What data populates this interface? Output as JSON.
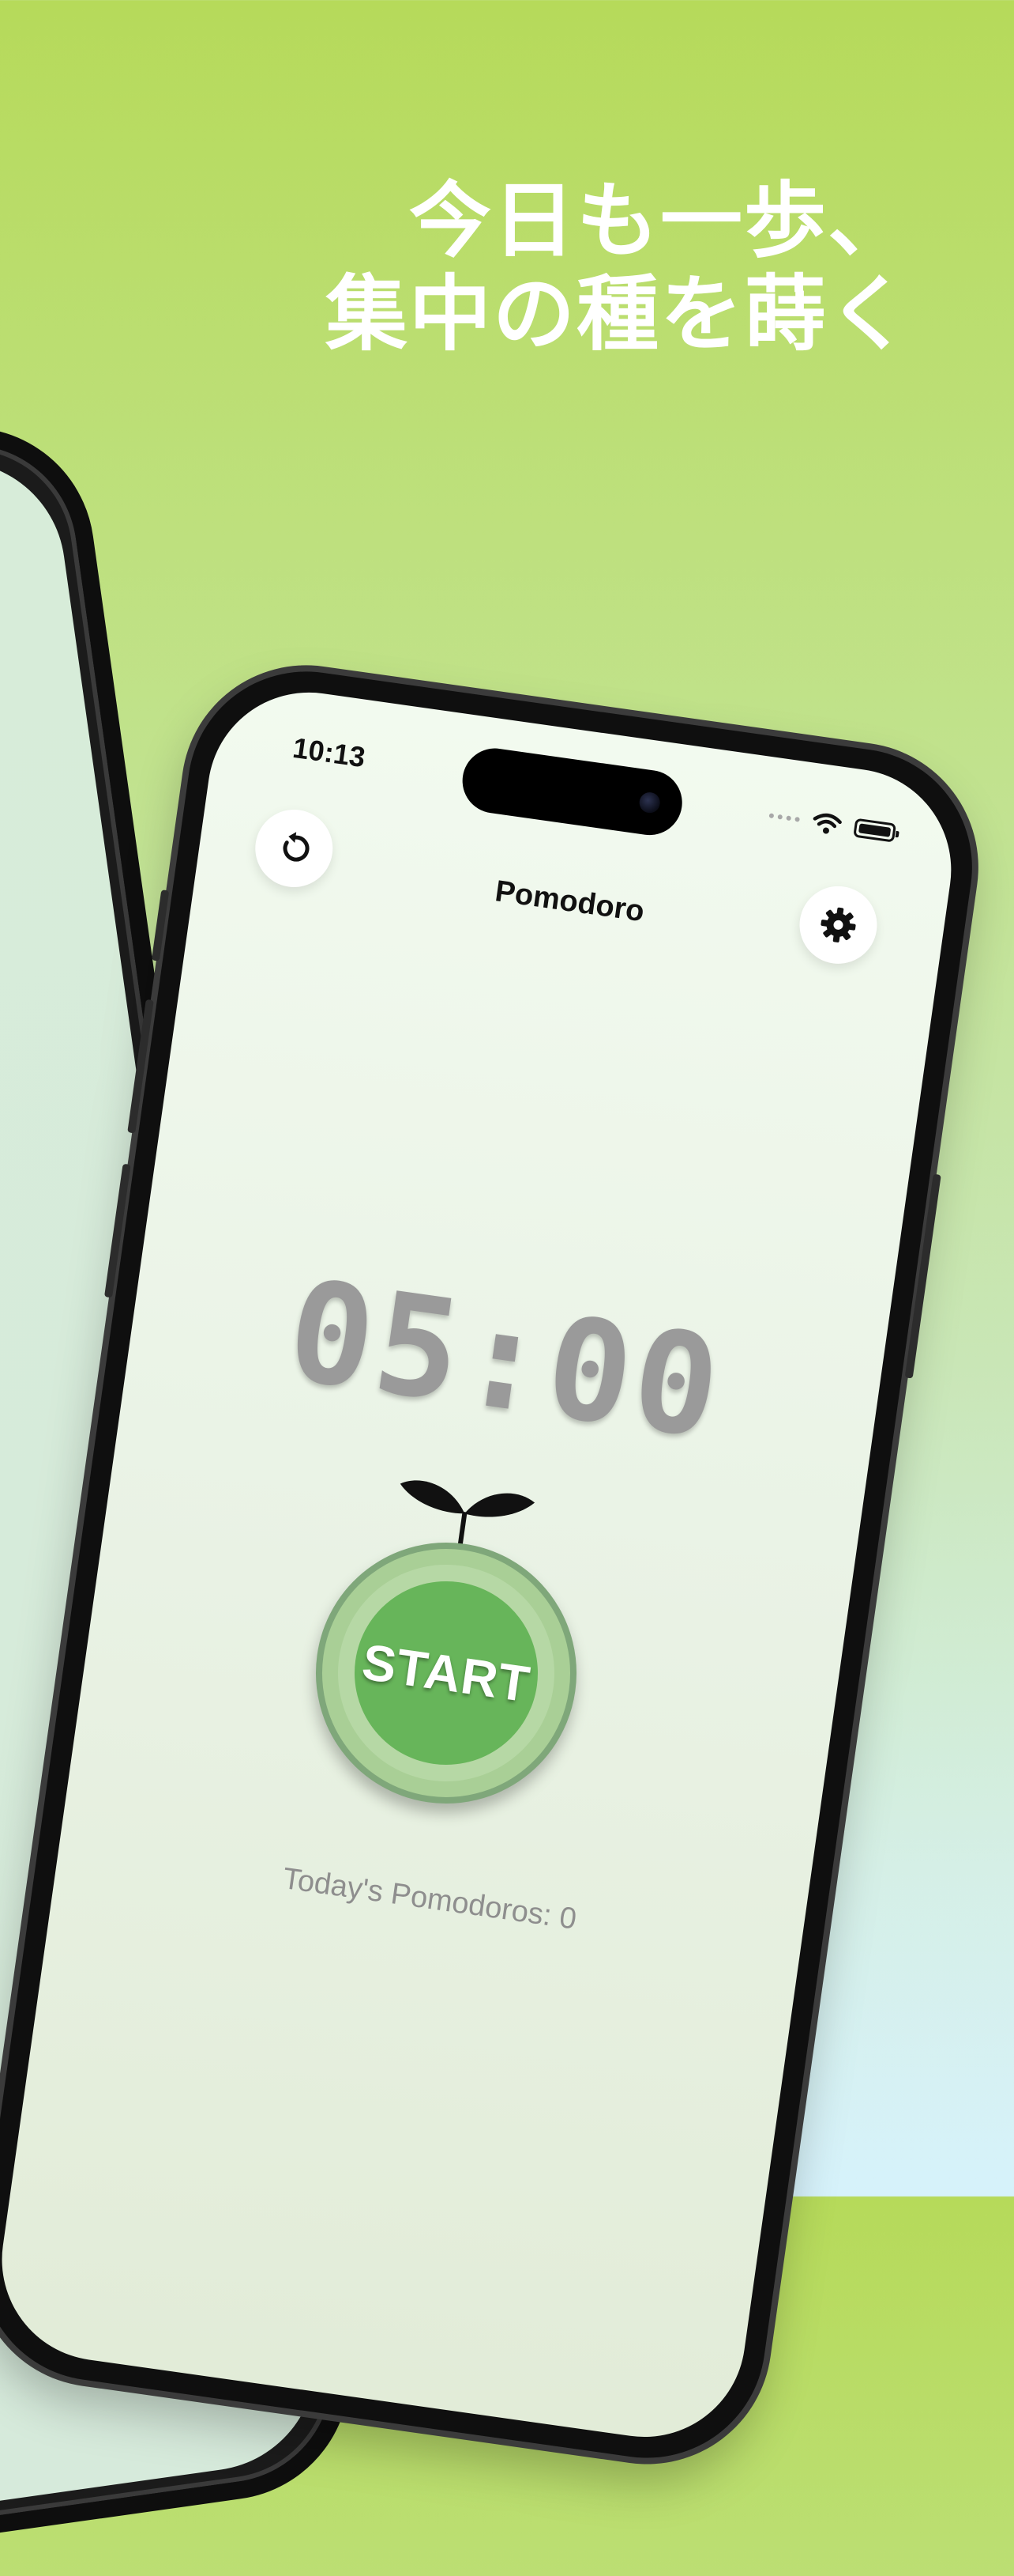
{
  "headline": {
    "line1": "今日も一歩、",
    "line2": "集中の種を蒔く"
  },
  "status_bar": {
    "time": "10:13"
  },
  "nav": {
    "title": "Pomodoro",
    "reset_icon": "reset-icon",
    "settings_icon": "gear-icon"
  },
  "timer": {
    "display": "05:00"
  },
  "start_button": {
    "label": "START"
  },
  "stats": {
    "today_label": "Today's Pomodoros: 0"
  },
  "colors": {
    "background_top": "#b6da5a",
    "background_bottom": "#d6f2fb",
    "start_green": "#67b55a",
    "timer_gray": "#9a9a9a"
  }
}
